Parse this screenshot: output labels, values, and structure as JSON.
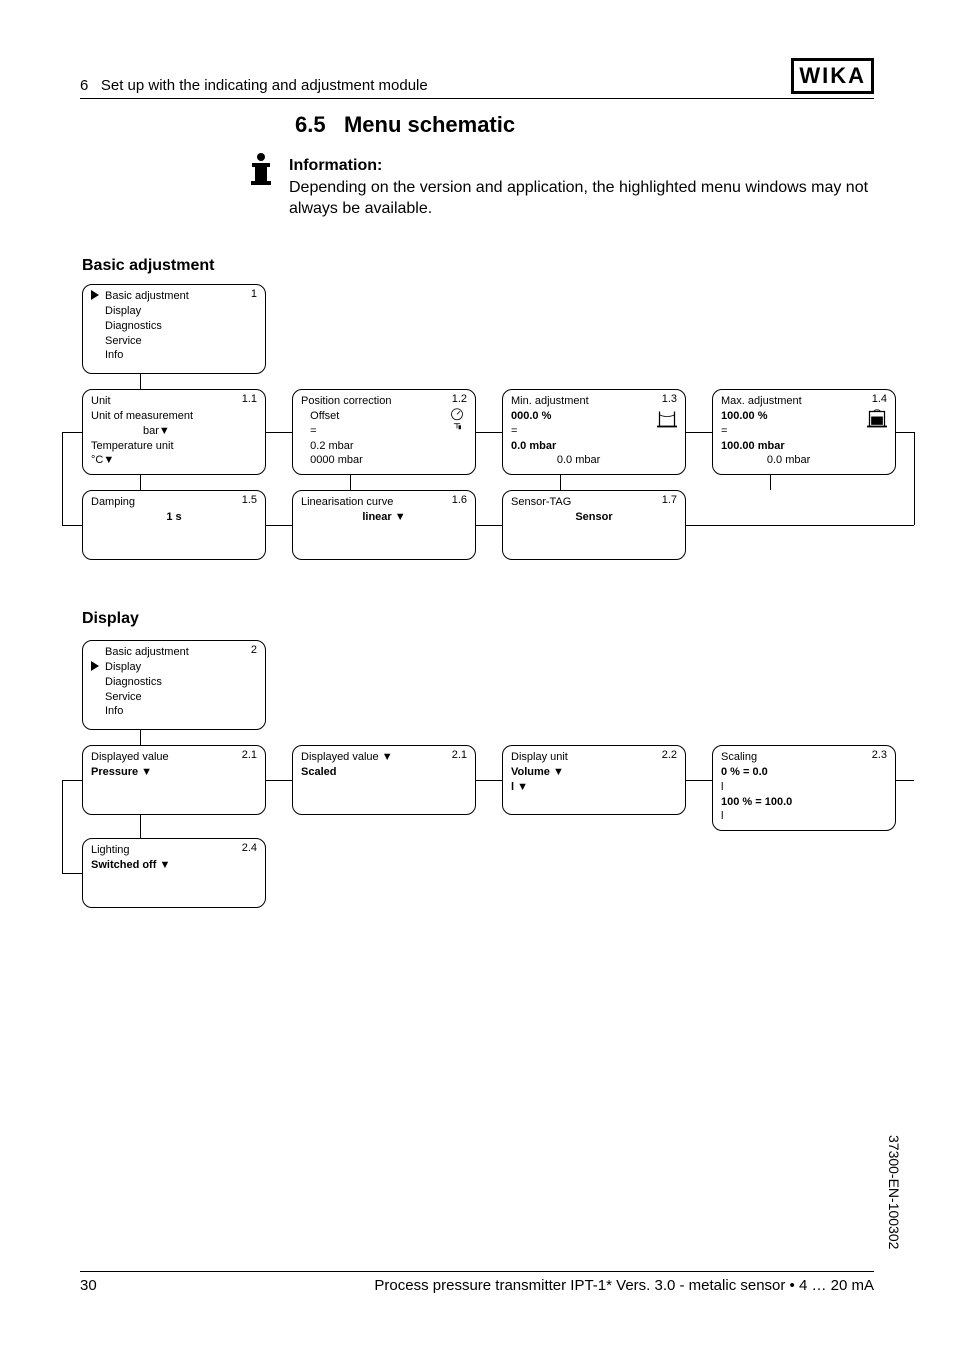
{
  "header": {
    "chapter_num": "6",
    "chapter_title": "Set up with the indicating and adjustment module",
    "logo": "WIKA"
  },
  "section": {
    "number": "6.5",
    "title": "Menu schematic"
  },
  "info": {
    "heading": "Information:",
    "body": "Depending on the version and application, the highlighted menu windows may not always be available."
  },
  "basic": {
    "heading": "Basic adjustment",
    "root": {
      "num": "1",
      "items": [
        "Basic adjustment",
        "Display",
        "Diagnostics",
        "Service",
        "Info"
      ],
      "selected": 0
    },
    "row1": [
      {
        "num": "1.1",
        "lines": [
          "Unit",
          "Unit of measurement",
          "                 bar▼",
          "Temperature unit",
          "°C▼"
        ]
      },
      {
        "num": "1.2",
        "lines": [
          "Position correction",
          "   Offset",
          "   =",
          "   0.2 mbar",
          "   0000 mbar"
        ],
        "icon": "dial"
      },
      {
        "num": "1.3",
        "lines": [
          "Min. adjustment",
          "000.0 %",
          "=",
          "0.0 mbar",
          "               0.0 mbar"
        ],
        "bold_lines": [
          1,
          3
        ],
        "icon": "tank-open"
      },
      {
        "num": "1.4",
        "lines": [
          "Max. adjustment",
          "100.00 %",
          "=",
          "100.00 mbar",
          "               0.0 mbar"
        ],
        "bold_lines": [
          1,
          3
        ],
        "icon": "tank-closed"
      }
    ],
    "row2": [
      {
        "num": "1.5",
        "lines": [
          "Damping",
          "",
          "1 s"
        ],
        "bold_lines": [
          2
        ],
        "center": [
          2
        ]
      },
      {
        "num": "1.6",
        "lines": [
          "Linearisation curve",
          "",
          "linear ▼"
        ],
        "bold_lines": [
          2
        ],
        "center": [
          2
        ]
      },
      {
        "num": "1.7",
        "lines": [
          "Sensor-TAG",
          "",
          "Sensor"
        ],
        "bold_lines": [
          2
        ],
        "center": [
          2
        ]
      }
    ]
  },
  "display": {
    "heading": "Display",
    "root": {
      "num": "2",
      "items": [
        "Basic adjustment",
        "Display",
        "Diagnostics",
        "Service",
        "Info"
      ],
      "selected": 1
    },
    "row1": [
      {
        "num": "2.1",
        "lines": [
          "Displayed value",
          "",
          "Pressure ▼"
        ],
        "bold_lines": [
          2
        ]
      },
      {
        "num": "2.1",
        "lines": [
          "Displayed value ▼",
          "",
          "Scaled"
        ],
        "bold_lines": [
          2
        ]
      },
      {
        "num": "2.2",
        "lines": [
          "Display unit",
          "",
          "Volume ▼",
          "l ▼"
        ],
        "bold_lines": [
          2,
          3
        ]
      },
      {
        "num": "2.3",
        "lines": [
          "Scaling",
          "0 % = 0.0",
          "l",
          "100 % = 100.0",
          "l"
        ],
        "bold_lines": [
          1,
          3
        ]
      }
    ],
    "row2": [
      {
        "num": "2.4",
        "lines": [
          "Lighting",
          "",
          "Switched off ▼"
        ],
        "bold_lines": [
          2
        ]
      }
    ]
  },
  "footer": {
    "page": "30",
    "text": "Process pressure transmitter IPT-1* Vers. 3.0 - metalic sensor • 4 … 20 mA"
  },
  "sidecode": "37300-EN-100302"
}
